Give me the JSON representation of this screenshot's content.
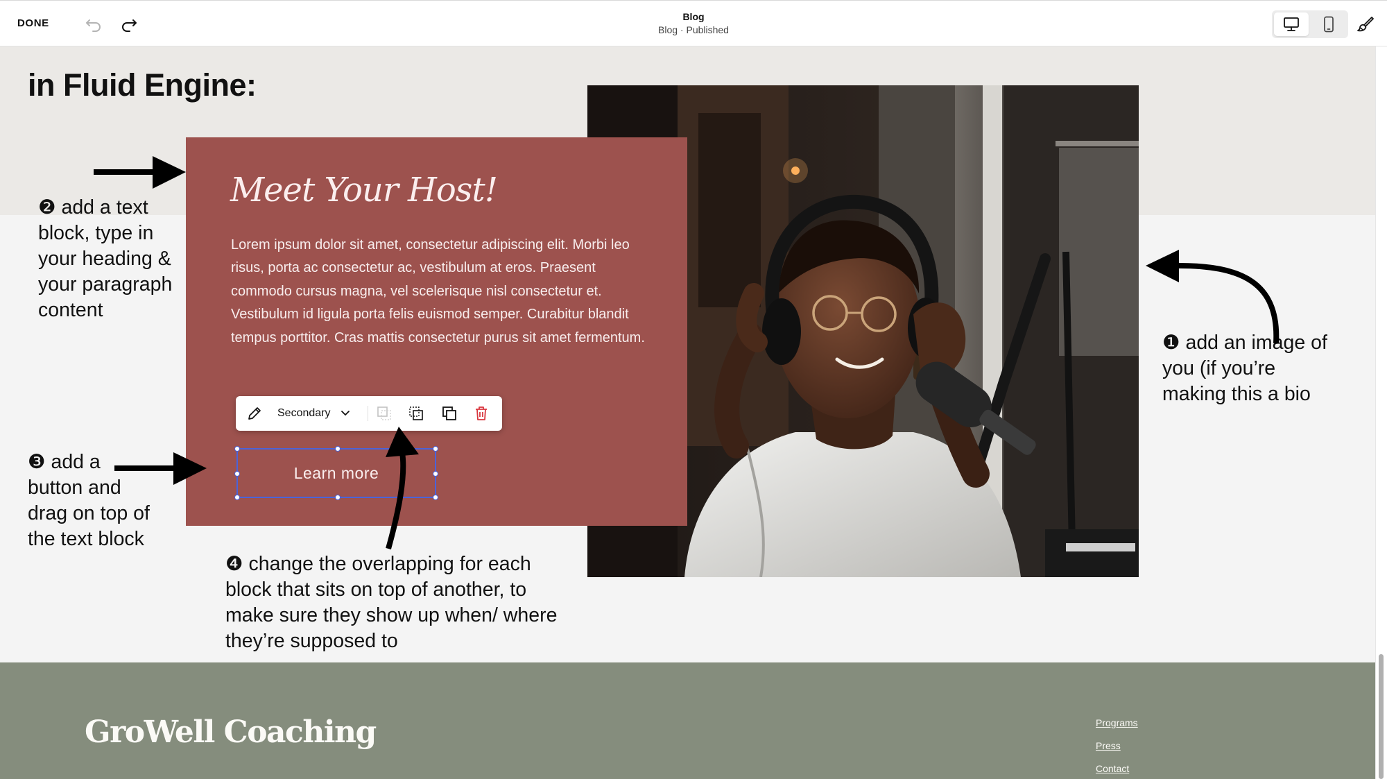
{
  "topbar": {
    "done_label": "DONE",
    "page_title": "Blog",
    "page_status": "Blog · Published",
    "icons": [
      "undo-icon",
      "redo-icon",
      "desktop-icon",
      "mobile-icon",
      "paintbrush-icon"
    ]
  },
  "section": {
    "heading": "in Fluid Engine:"
  },
  "card": {
    "heading": "Meet Your Host!",
    "body": "Lorem ipsum dolor sit amet, consectetur adipiscing elit. Morbi leo risus, porta ac consectetur ac, vestibulum at eros. Praesent commodo cursus magna, vel scelerisque nisl consectetur et. Vestibulum id ligula porta felis euismod semper. Curabitur blandit tempus porttitor. Cras mattis consectetur purus sit amet fermentum.",
    "background": "#9d524e"
  },
  "toolbar": {
    "style_label": "Secondary",
    "icons": [
      "pencil-icon",
      "chevron-down-icon",
      "send-backward-icon",
      "bring-forward-icon",
      "duplicate-icon",
      "trash-icon"
    ]
  },
  "button": {
    "label": "Learn more",
    "selection_color": "#4b63d8"
  },
  "annotations": {
    "step1": "❶ add an image of you (if you’re making this a bio",
    "step2": "❷ add a text block, type in your heading & your paragraph content",
    "step3": "❸ add a button and drag on top of the text block",
    "step4": "❹ change the overlapping for each block that sits on top of another, to make sure they show up when/ where they’re supposed to"
  },
  "footer": {
    "brand": "GroWell Coaching",
    "links": [
      "Programs",
      "Press",
      "Contact"
    ],
    "background": "#858d7d"
  }
}
